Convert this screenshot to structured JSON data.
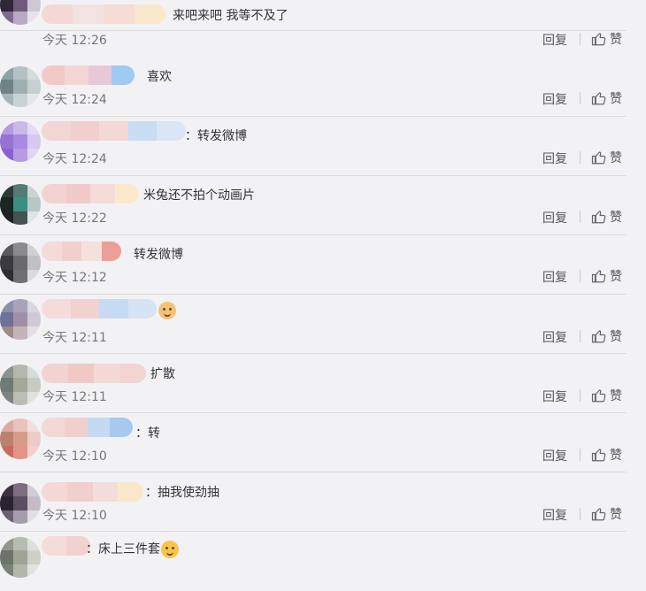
{
  "comments": [
    {
      "text": "来吧来吧 我等不及了",
      "time": "今天 12:26"
    },
    {
      "text": "喜欢",
      "time": "今天 12:24"
    },
    {
      "text": "：转发微博",
      "time": "今天 12:24"
    },
    {
      "text": "米兔还不拍个动画片",
      "time": "今天 12:22"
    },
    {
      "text": "转发微博",
      "time": "今天 12:12"
    },
    {
      "text": "",
      "time": "今天 12:11",
      "emoji": "cat-face-icon"
    },
    {
      "text": "扩散",
      "time": "今天 12:11"
    },
    {
      "text": "：转",
      "time": "今天 12:10"
    },
    {
      "text": "：抽我使劲抽",
      "time": "今天 12:10"
    },
    {
      "text": "：床上三件套",
      "time": "",
      "emoji": "smile-face-icon"
    }
  ],
  "actions": {
    "reply_label": "回复",
    "like_label": "赞"
  },
  "colors": {
    "background": "#f2f2f5",
    "text": "#333333",
    "meta": "#777777",
    "divider": "#dcdce0"
  }
}
